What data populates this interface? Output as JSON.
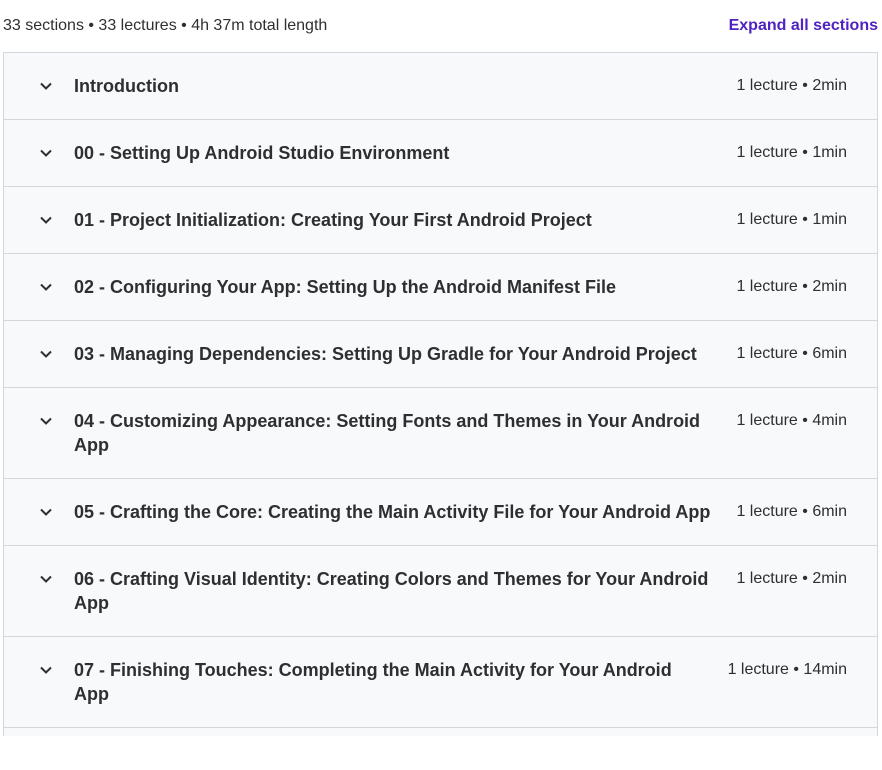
{
  "header": {
    "summary": "33 sections • 33 lectures • 4h 37m total length",
    "expand_all_label": "Expand all sections"
  },
  "icons": {
    "section_toggle": "chevron-down-icon"
  },
  "colors": {
    "accent": "#5022c3",
    "section_bg": "#f7f9fa",
    "border": "#d1d7dc",
    "text": "#2d2f31"
  },
  "sections": [
    {
      "title": "Introduction",
      "meta": "1 lecture • 2min"
    },
    {
      "title": "00 - Setting Up Android Studio Environment",
      "meta": "1 lecture • 1min"
    },
    {
      "title": "01 - Project Initialization: Creating Your First Android Project",
      "meta": "1 lecture • 1min"
    },
    {
      "title": "02 - Configuring Your App: Setting Up the Android Manifest File",
      "meta": "1 lecture • 2min"
    },
    {
      "title": "03 - Managing Dependencies: Setting Up Gradle for Your Android Project",
      "meta": "1 lecture • 6min"
    },
    {
      "title": "04 - Customizing Appearance: Setting Fonts and Themes in Your Android App",
      "meta": "1 lecture • 4min"
    },
    {
      "title": "05 - Crafting the Core: Creating the Main Activity File for Your Android App",
      "meta": "1 lecture • 6min"
    },
    {
      "title": "06 - Crafting Visual Identity: Creating Colors and Themes for Your Android App",
      "meta": "1 lecture • 2min"
    },
    {
      "title": "07 - Finishing Touches: Completing the Main Activity for Your Android App",
      "meta": "1 lecture • 14min"
    }
  ]
}
